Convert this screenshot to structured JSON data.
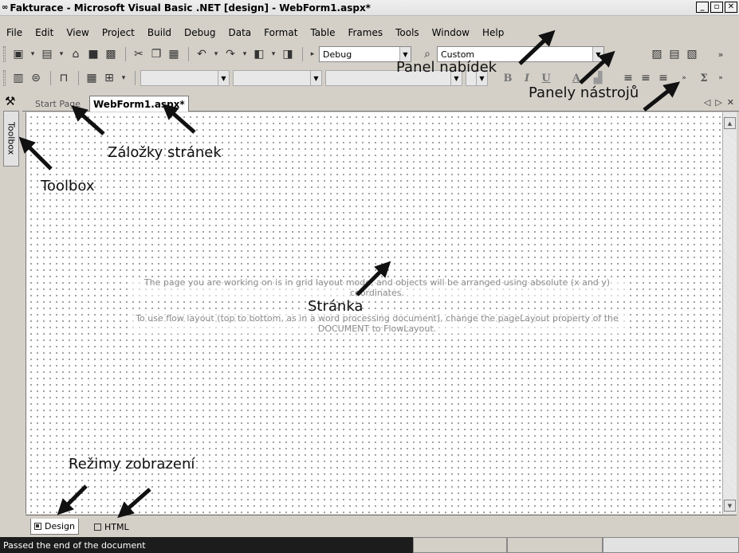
{
  "window": {
    "app_icon": "∞",
    "title": "Fakturace - Microsoft Visual Basic .NET [design] - WebForm1.aspx*",
    "controls": [
      "_",
      "▫",
      "✕"
    ]
  },
  "menu": [
    "File",
    "Edit",
    "View",
    "Project",
    "Build",
    "Debug",
    "Data",
    "Format",
    "Table",
    "Frames",
    "Tools",
    "Window",
    "Help"
  ],
  "toolbar": {
    "config_combo": "Debug",
    "platform_combo": "Custom"
  },
  "formatting": {
    "bold": "B",
    "italic": "I",
    "underline": "U",
    "sigma": "Σ",
    "overflow": "»"
  },
  "toolbox": {
    "label": "Toolbox",
    "icon": "hammer-icon"
  },
  "tabs": {
    "start_page": "Start Page",
    "active": "WebForm1.aspx*",
    "nav": [
      "◁",
      "▷",
      "✕"
    ]
  },
  "canvas": {
    "hint_line1": "The page you are working on is in grid layout mode, and objects will be arranged using absolute (x and y) coordinates.",
    "hint_line2": "To use flow layout (top to bottom, as in a word processing document), change the pageLayout property of the DOCUMENT to FlowLayout."
  },
  "view_modes": {
    "design": "Design",
    "html": "HTML"
  },
  "status": {
    "message": "Passed the end of the document"
  },
  "annotations": {
    "menu_panel": "Panel nabídek",
    "toolbars": "Panely nástrojů",
    "page_tabs": "Záložky stránek",
    "toolbox": "Toolbox",
    "page": "Stránka",
    "view_modes": "Režimy zobrazení"
  }
}
